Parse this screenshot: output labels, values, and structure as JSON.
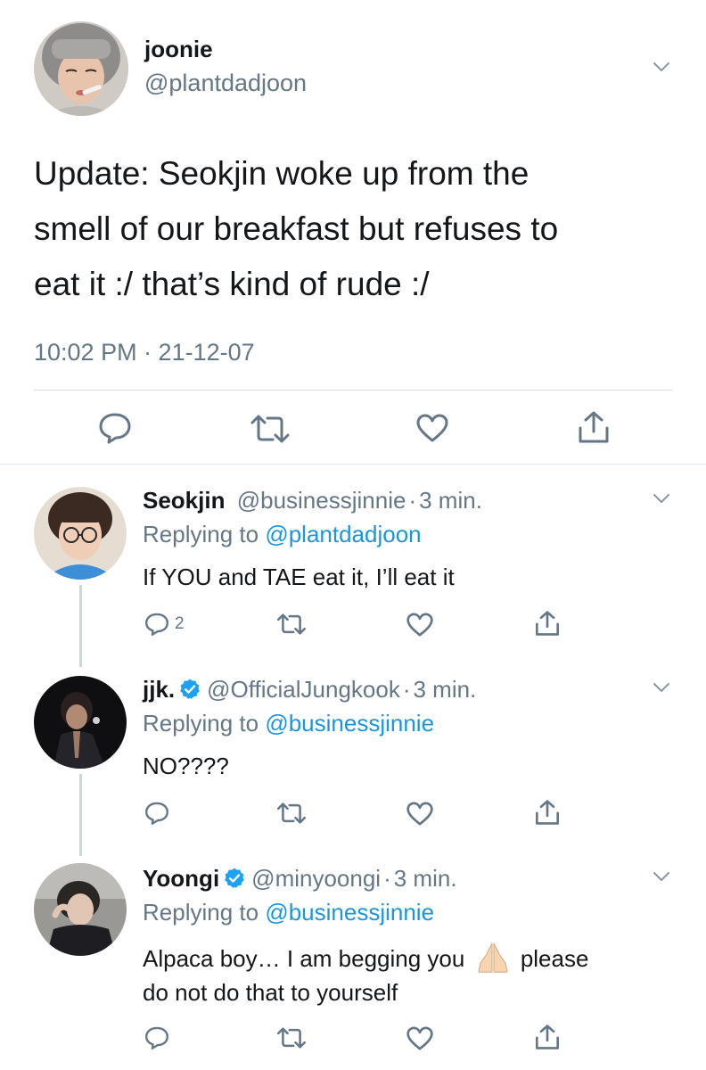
{
  "main_tweet": {
    "display_name": "joonie",
    "handle": "@plantdadjoon",
    "text_lines": [
      "Update: Seokjin woke up from the",
      "smell of our breakfast but refuses to",
      "eat it :/ that’s kind of rude :/"
    ],
    "timestamp": "10:02 PM · 21-12-07"
  },
  "replies": [
    {
      "display_name": "Seokjin",
      "handle": "@businessjinnie",
      "time": "3 min.",
      "replying_prefix": "Replying to",
      "replying_to": "@plantdadjoon",
      "text_lines": [
        "If YOU and TAE eat it, I’ll eat it"
      ],
      "reply_count": "2",
      "verified": false
    },
    {
      "display_name": "jjk.",
      "handle": "@OfficialJungkook",
      "time": "3 min.",
      "replying_prefix": "Replying to",
      "replying_to": "@businessjinnie",
      "text_lines": [
        "NO????"
      ],
      "verified": true
    },
    {
      "display_name": "Yoongi",
      "handle": "@minyoongi",
      "time": "3 min.",
      "replying_prefix": "Replying to",
      "replying_to": "@businessjinnie",
      "text_lines": [
        "Alpaca boy… I am begging you",
        "please",
        "do not do that to yourself"
      ],
      "verified": true
    }
  ],
  "separator": "·",
  "icons": {
    "reply": "reply-icon",
    "retweet": "retweet-icon",
    "like": "heart-icon",
    "share": "share-icon",
    "menu": "chevron-down-icon",
    "verified": "verified-badge-icon",
    "emoji": "folded-hands-emoji"
  },
  "colors": {
    "link": "#1b95e0",
    "muted": "#657786",
    "verified": "#1da1f2",
    "text": "#14171a"
  }
}
